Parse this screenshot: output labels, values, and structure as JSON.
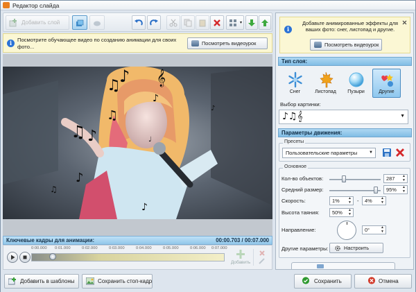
{
  "window": {
    "title": "Редактор слайда"
  },
  "toolbar": {
    "add_layer_label": "Добавить слой"
  },
  "hint": {
    "text": "Посмотрите обучающее видео по созданию анимации для своих фото...",
    "button_label": "Посмотреть видеоурок"
  },
  "keyframes": {
    "title": "Ключевые кадры для анимации:",
    "time": "00:00.703 / 00:07.000",
    "ticks": [
      "0:00.000",
      "0:01.000",
      "0:02.000",
      "0:03.000",
      "0:04.000",
      "0:05.000",
      "0:06.000",
      "0:07.000"
    ],
    "add_label": "Добавить",
    "position": 0.1
  },
  "bottom": {
    "templates_label": "Добавить в шаблоны",
    "stopframe_label": "Сохранить стоп-кадр",
    "save_label": "Сохранить",
    "cancel_label": "Отмена"
  },
  "panel": {
    "tip_text": "Добавьте анимированные эффекты для ваших фото: снег, листопад и другие.",
    "tip_button": "Посмотреть видеоурок",
    "layer_type_title": "Тип слоя:",
    "layer_types": [
      {
        "label": "Снег",
        "icon": "snowflake-icon"
      },
      {
        "label": "Листопад",
        "icon": "maple-leaf-icon"
      },
      {
        "label": "Пузыри",
        "icon": "bubble-icon"
      },
      {
        "label": "Другие",
        "icon": "hearts-star-icon",
        "selected": true
      }
    ],
    "picture_select_label": "Выбор картинки:",
    "picture_value": "♪♫𝄞",
    "motion_title": "Параметры движения:",
    "presets_title": "Пресеты",
    "preset_value": "Пользовательские параметры",
    "basic_title": "Основное",
    "count_label": "Кол-во объектов:",
    "count_value": "287",
    "count_level": 0.26,
    "size_label": "Средний размер:",
    "size_value": "95%",
    "size_level": 0.95,
    "speed_label": "Скорость:",
    "speed_from": "1%",
    "speed_dash": "-",
    "speed_to": "4%",
    "melt_label": "Высота таяния:",
    "melt_value": "50%",
    "direction_label": "Направление:",
    "direction_value": "0°",
    "other_label": "Другие параметры:",
    "other_button": "Настроить"
  },
  "colors": {
    "accent": "#86c2ea",
    "save_green": "#2f9a2f",
    "cancel_red": "#d23a2a"
  }
}
